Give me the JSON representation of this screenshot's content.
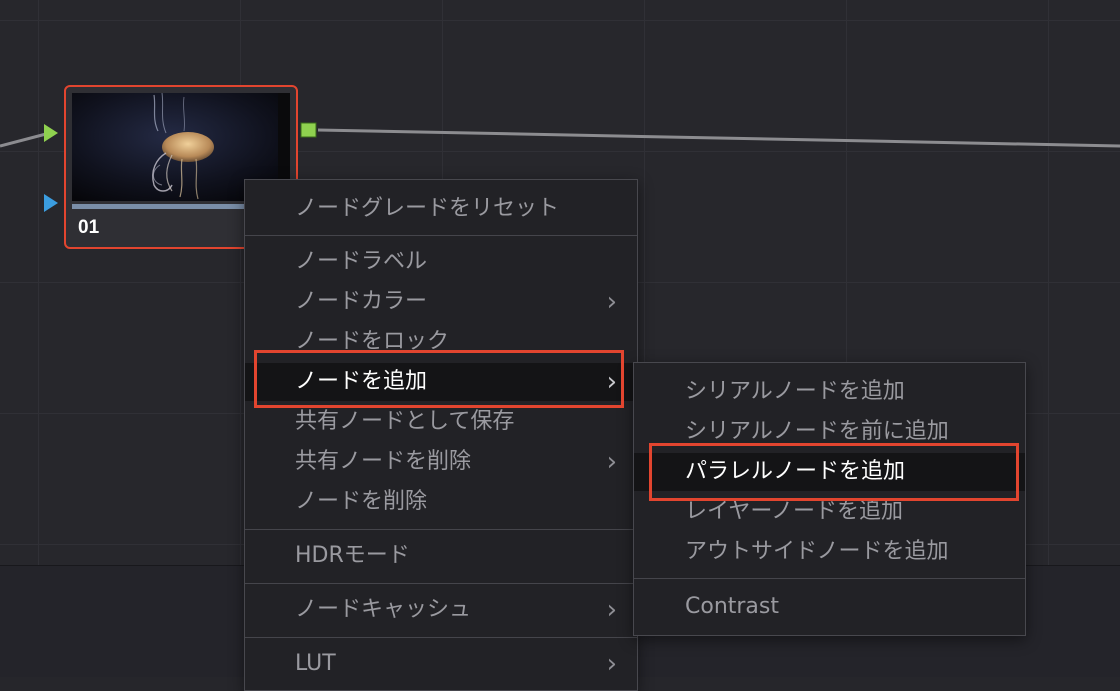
{
  "node": {
    "number": "01"
  },
  "context_menu": {
    "items": [
      {
        "label": "ノードグレードをリセット"
      },
      {
        "label": "ノードラベル"
      },
      {
        "label": "ノードカラー",
        "chevron": "›"
      },
      {
        "label": "ノードをロック"
      },
      {
        "label": "ノードを追加",
        "chevron": "›"
      },
      {
        "label": "共有ノードとして保存"
      },
      {
        "label": "共有ノードを削除",
        "chevron": "›"
      },
      {
        "label": "ノードを削除"
      },
      {
        "label": "HDRモード"
      },
      {
        "label": "ノードキャッシュ",
        "chevron": "›"
      },
      {
        "label": "LUT",
        "chevron": "›"
      }
    ]
  },
  "submenu": {
    "items": [
      {
        "label": "シリアルノードを追加"
      },
      {
        "label": "シリアルノードを前に追加"
      },
      {
        "label": "パラレルノードを追加"
      },
      {
        "label": "レイヤーノードを追加"
      },
      {
        "label": "アウトサイドノードを追加"
      },
      {
        "label": "Contrast"
      }
    ]
  },
  "colors": {
    "highlight_outline": "#e2452f",
    "rgb_port": "#8fd14f",
    "alpha_port": "#3b9de0"
  }
}
